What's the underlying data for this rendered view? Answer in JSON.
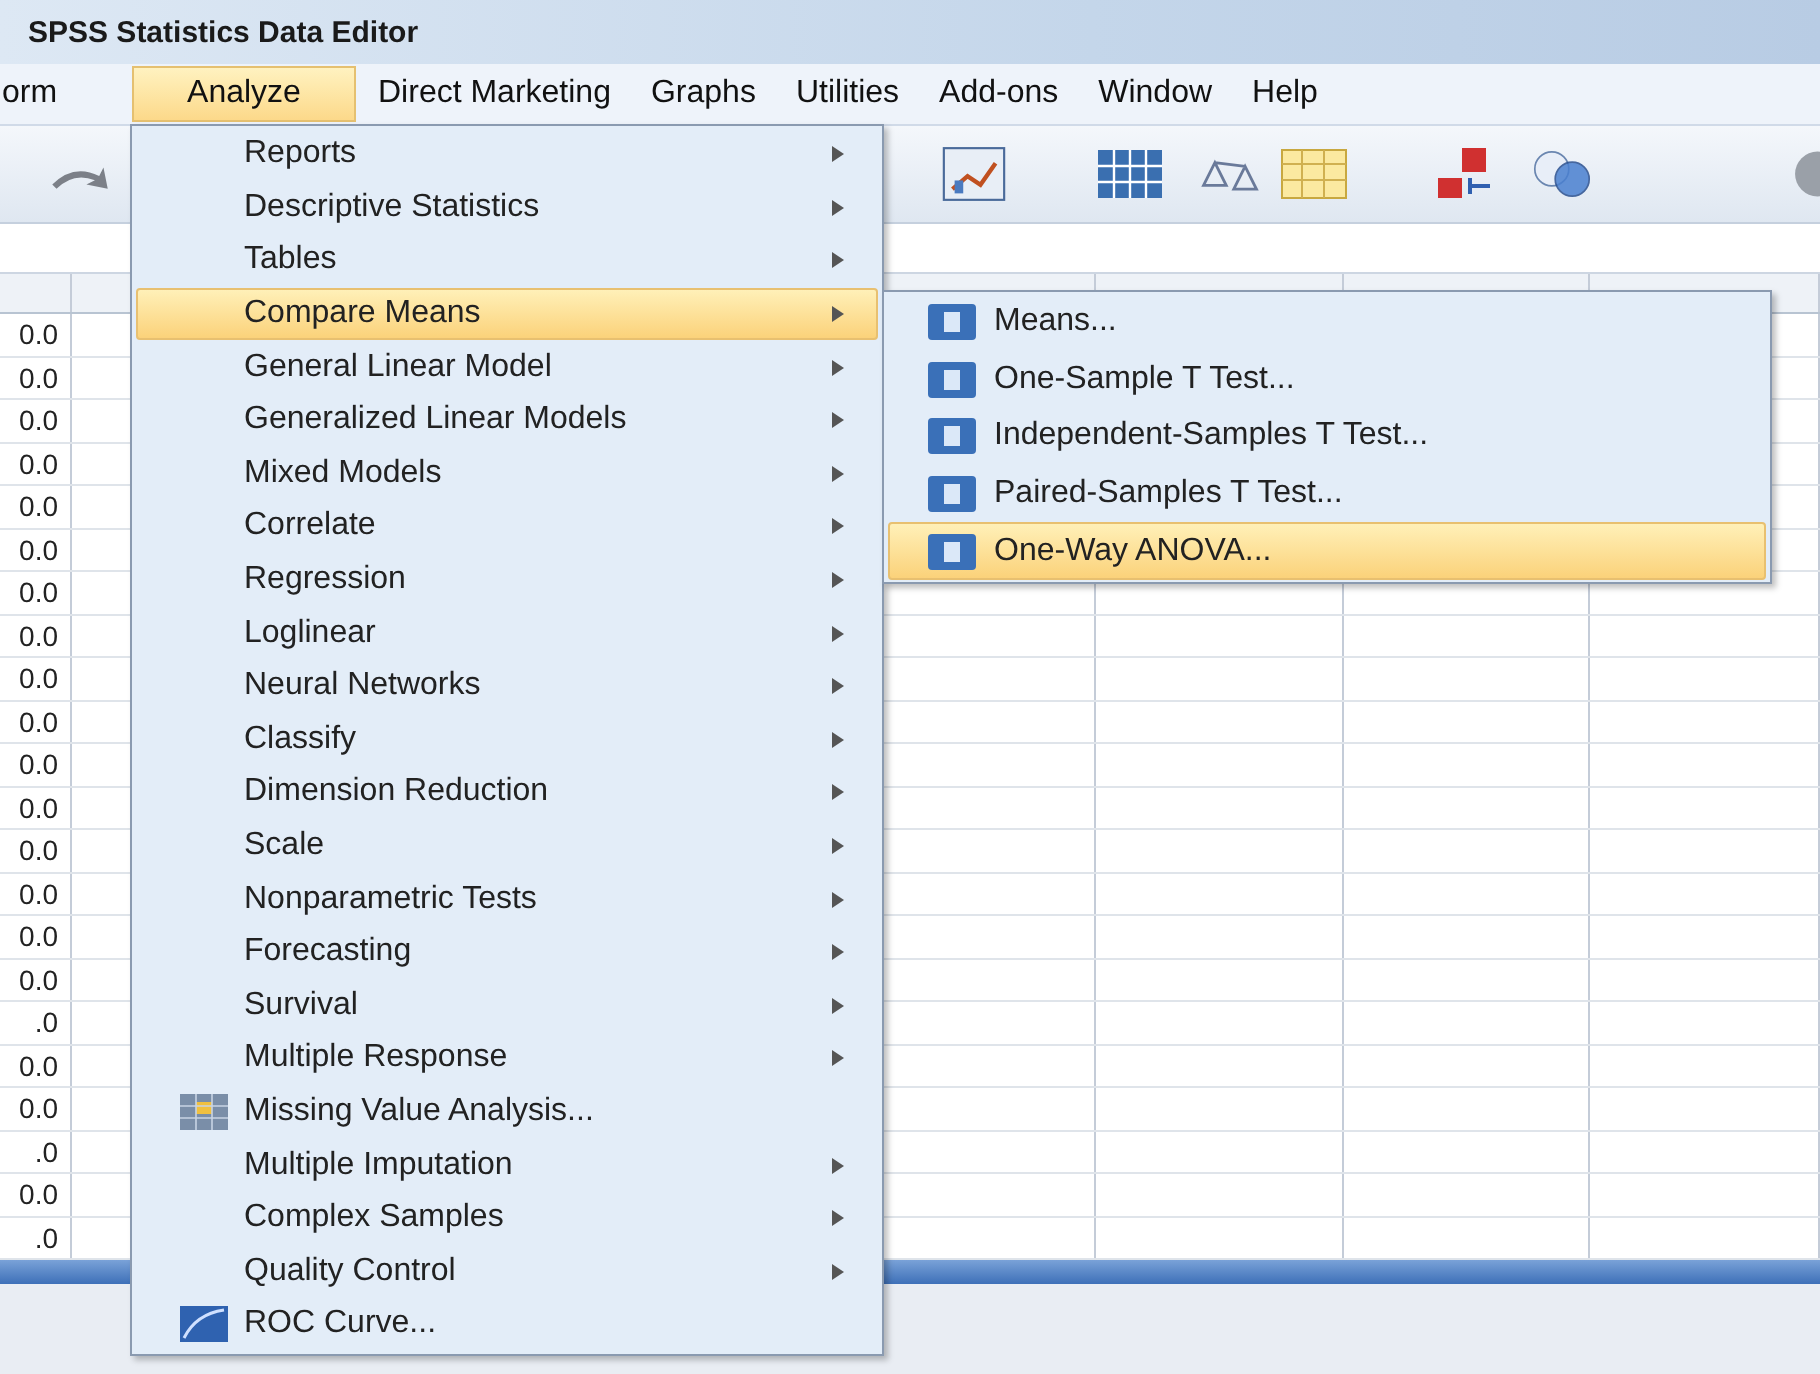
{
  "window": {
    "title": "SPSS Statistics Data Editor"
  },
  "menubar": [
    {
      "label": "orm",
      "selected": false
    },
    {
      "label": "Analyze",
      "selected": true
    },
    {
      "label": "Direct Marketing",
      "selected": false
    },
    {
      "label": "Graphs",
      "selected": false
    },
    {
      "label": "Utilities",
      "selected": false
    },
    {
      "label": "Add-ons",
      "selected": false
    },
    {
      "label": "Window",
      "selected": false
    },
    {
      "label": "Help",
      "selected": false
    }
  ],
  "grid": {
    "column_1": [
      "0.0",
      "0.0",
      "0.0",
      "0.0",
      "0.0",
      "0.0",
      "0.0",
      "0.0",
      "0.0",
      "0.0",
      "0.0",
      "0.0",
      "0.0",
      "0.0",
      "0.0",
      "0.0",
      ".0",
      "0.0",
      "0.0",
      ".0",
      "0.0",
      ".0"
    ]
  },
  "analyze_menu": [
    {
      "label": "Reports",
      "kind": "submenu",
      "selected": false
    },
    {
      "label": "Descriptive Statistics",
      "kind": "submenu",
      "selected": false
    },
    {
      "label": "Tables",
      "kind": "submenu",
      "selected": false
    },
    {
      "label": "Compare Means",
      "kind": "submenu",
      "selected": true
    },
    {
      "label": "General Linear Model",
      "kind": "submenu",
      "selected": false
    },
    {
      "label": "Generalized Linear Models",
      "kind": "submenu",
      "selected": false
    },
    {
      "label": "Mixed Models",
      "kind": "submenu",
      "selected": false
    },
    {
      "label": "Correlate",
      "kind": "submenu",
      "selected": false
    },
    {
      "label": "Regression",
      "kind": "submenu",
      "selected": false
    },
    {
      "label": "Loglinear",
      "kind": "submenu",
      "selected": false
    },
    {
      "label": "Neural Networks",
      "kind": "submenu",
      "selected": false
    },
    {
      "label": "Classify",
      "kind": "submenu",
      "selected": false
    },
    {
      "label": "Dimension Reduction",
      "kind": "submenu",
      "selected": false
    },
    {
      "label": "Scale",
      "kind": "submenu",
      "selected": false
    },
    {
      "label": "Nonparametric Tests",
      "kind": "submenu",
      "selected": false
    },
    {
      "label": "Forecasting",
      "kind": "submenu",
      "selected": false
    },
    {
      "label": "Survival",
      "kind": "submenu",
      "selected": false
    },
    {
      "label": "Multiple Response",
      "kind": "submenu",
      "selected": false
    },
    {
      "label": "Missing Value Analysis...",
      "kind": "dialog",
      "selected": false
    },
    {
      "label": "Multiple Imputation",
      "kind": "submenu",
      "selected": false
    },
    {
      "label": "Complex Samples",
      "kind": "submenu",
      "selected": false
    },
    {
      "label": "Quality Control",
      "kind": "submenu",
      "selected": false
    },
    {
      "label": "ROC Curve...",
      "kind": "dialog",
      "selected": false
    }
  ],
  "compare_means_submenu": [
    {
      "label": "Means...",
      "selected": false
    },
    {
      "label": "One-Sample T Test...",
      "selected": false
    },
    {
      "label": "Independent-Samples T Test...",
      "selected": false
    },
    {
      "label": "Paired-Samples T Test...",
      "selected": false
    },
    {
      "label": "One-Way ANOVA...",
      "selected": true
    }
  ]
}
